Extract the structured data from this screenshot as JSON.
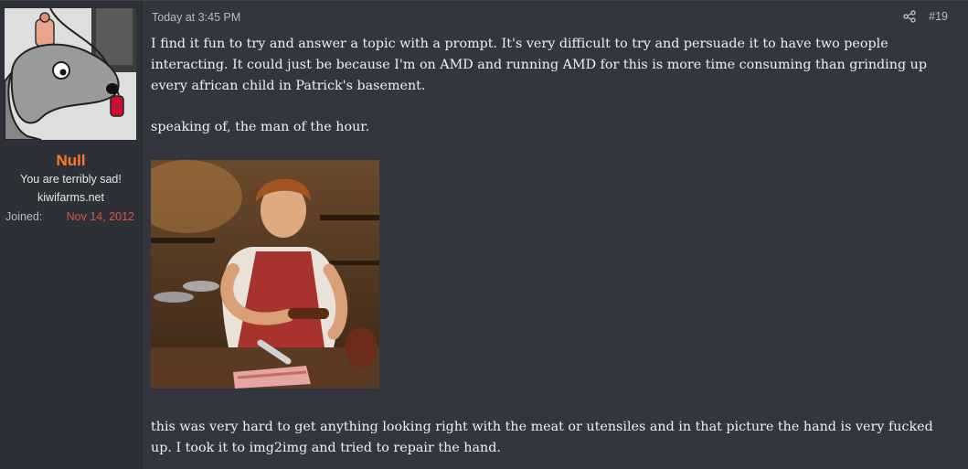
{
  "user": {
    "name": "Null",
    "title_line1": "You are terribly sad!",
    "title_line2": "kiwifarms.net",
    "joined_label": "Joined:",
    "joined_date": "Nov 14, 2012"
  },
  "post": {
    "timestamp": "Today at 3:45 PM",
    "number": "#19",
    "paragraphs": [
      "I find it fun to try and answer a topic with a prompt. It's very difficult to try and persuade it to have two people interacting. It could just be because I'm on AMD and running AMD for this is more time consuming than grinding up every african child in Patrick's basement.",
      "speaking of, the man of the hour.",
      "this was very hard to get anything looking right with the meat or utensiles and in that picture the hand is very fucked up. I took it to img2img and tried to repair the hand."
    ]
  },
  "icons": {
    "share": "share-icon"
  },
  "colors": {
    "username": "#ff7a22",
    "joined_date": "#d9534f",
    "post_background": "#33363e"
  }
}
